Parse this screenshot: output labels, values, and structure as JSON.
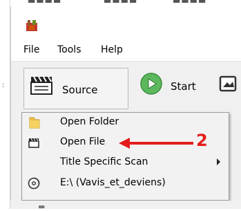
{
  "window": {
    "icon": "handbrake-app-icon"
  },
  "menubar": {
    "items": [
      {
        "label": "File"
      },
      {
        "label": "Tools"
      },
      {
        "label": "Help"
      }
    ]
  },
  "toolbar": {
    "source_label": "Source",
    "start_label": "Start",
    "source_icon": "clapperboard-icon",
    "start_icon": "play-icon",
    "preview_icon": "preview-icon"
  },
  "source_menu": {
    "items": [
      {
        "label": "Open Folder",
        "icon": "folder-icon",
        "has_submenu": false
      },
      {
        "label": "Open File",
        "icon": "file-icon",
        "has_submenu": false
      },
      {
        "label": "Title Specific Scan",
        "icon": "",
        "has_submenu": true
      },
      {
        "label": "E:\\ (Vavis_et_deviens)",
        "icon": "disc-icon",
        "has_submenu": false
      }
    ]
  },
  "annotation": {
    "number": "2",
    "color": "#e41b1b"
  }
}
